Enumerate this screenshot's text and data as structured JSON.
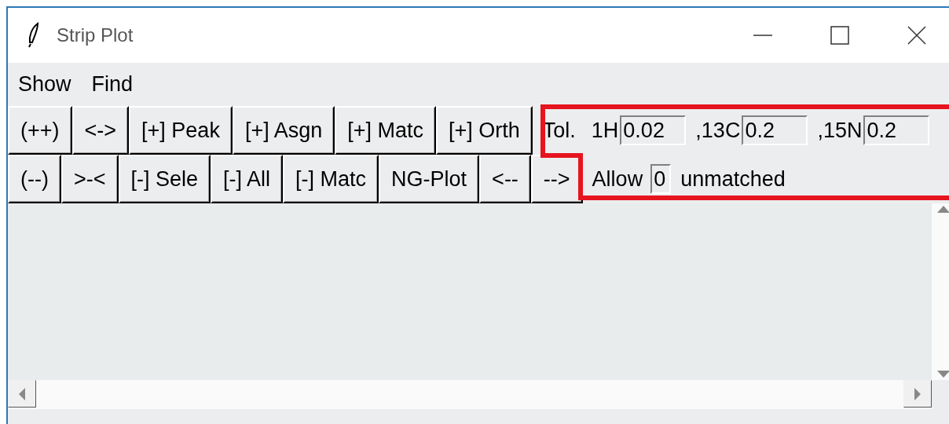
{
  "window": {
    "title": "Strip Plot"
  },
  "menu": [
    "Show",
    "Find"
  ],
  "toolbar_rows": [
    [
      "(++)",
      "<->",
      "[+] Peak",
      "[+] Asgn",
      "[+] Matc",
      "[+] Orth"
    ],
    [
      "(--)",
      ">-<",
      "[-] Sele",
      "[-] All",
      "[-] Matc",
      "NG-Plot",
      "<--",
      "-->"
    ]
  ],
  "tolerance": {
    "label": "Tol.",
    "fields": [
      {
        "label": "1H",
        "value": "0.02"
      },
      {
        "label": ",13C",
        "value": "0.2"
      },
      {
        "label": ",15N",
        "value": "0.2"
      }
    ]
  },
  "allow": {
    "label": "Allow",
    "value": "0",
    "suffix": "unmatched"
  },
  "annotation": {
    "kind": "outline"
  }
}
